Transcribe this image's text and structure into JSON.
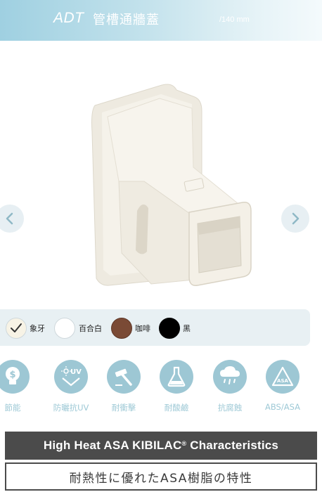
{
  "header": {
    "brand": "ADT",
    "name": "管槽通牆蓋",
    "size": "/140 mm"
  },
  "gallery": {
    "prev_icon": "chevron-left-icon",
    "next_icon": "chevron-right-icon",
    "product_color": "#f4f1e8"
  },
  "colors": {
    "selected_index": 0,
    "options": [
      {
        "label": "象牙",
        "hex": "#f7f3e6"
      },
      {
        "label": "百合白",
        "hex": "#ffffff"
      },
      {
        "label": "咖啡",
        "hex": "#7a4a35"
      },
      {
        "label": "黑",
        "hex": "#000000"
      }
    ]
  },
  "features": [
    {
      "label": "節能",
      "icon": "bulb-dollar-icon"
    },
    {
      "label": "防曬抗UV",
      "icon": "sun-uv-icon"
    },
    {
      "label": "耐衝擊",
      "icon": "hammer-icon"
    },
    {
      "label": "耐酸鹼",
      "icon": "flask-icon"
    },
    {
      "label": "抗腐蝕",
      "icon": "cloud-rain-icon"
    },
    {
      "label": "ABS/ASA",
      "icon": "recycle-asa-icon"
    }
  ],
  "spec": {
    "title_main": "High Heat ASA KIBILAC",
    "title_reg": "®",
    "title_tail": " Characteristics",
    "subtitle": "耐熱性に優れたASA樹脂の特性"
  },
  "theme": {
    "accent": "#9dc7d4",
    "panel": "#e8f0f3",
    "dark": "#4b4b4b"
  }
}
